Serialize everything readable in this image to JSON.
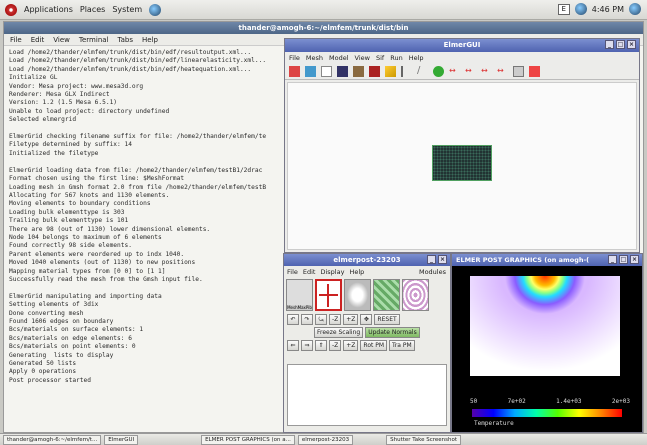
{
  "topbar": {
    "menus": [
      "Applications",
      "Places",
      "System"
    ],
    "clock": "4:46 PM"
  },
  "terminal": {
    "title": "thander@amogh-6:~/elmfem/trunk/dist/bin",
    "menus": [
      "File",
      "Edit",
      "View",
      "Terminal",
      "Tabs",
      "Help"
    ],
    "lines": [
      "Load /home2/thander/elmfem/trunk/dist/bin/edf/resultoutput.xml...",
      "Load /home2/thander/elmfem/trunk/dist/bin/edf/linearelasticity.xml...",
      "Load /home2/thander/elmfem/trunk/dist/bin/edf/heatequation.xml...",
      "Initialize GL",
      "Vendor: Mesa project: www.mesa3d.org",
      "Renderer: Mesa GLX Indirect",
      "Version: 1.2 (1.5 Mesa 6.5.1)",
      "Unable to load project: directory undefined",
      "Selected elmergrid",
      "",
      "ElmerGrid checking filename suffix for file: /home2/thander/elmfem/te",
      "Filetype determined by suffix: 14",
      "Initialized the filetype",
      "",
      "ElmerGrid loading data from file: /home2/thander/elmfem/testB1/2drac",
      "Format chosen using the first line: $MeshFormat",
      "Loading mesh in Gmsh format 2.0 from file /home2/thander/elmfem/testB",
      "Allocating for 567 knots and 1130 elements.",
      "Moving elements to boundary conditions",
      "Loading bulk elementtype is 303",
      "Trailing bulk elementtype is 101",
      "There are 98 (out of 1130) lower dimensional elements.",
      "Node 104 belongs to maximum of 6 elements",
      "Found correctly 98 side elements.",
      "Parent elements were reordered up to indx 1040.",
      "Moved 1040 elements (out of 1130) to new positions",
      "Mapping material types from [0 0] to [1 1]",
      "Successfully read the mesh from the Gmsh input file.",
      "",
      "ElmerGrid manipulating and importing data",
      "Setting elements of 3dix",
      "Done converting mesh",
      "Found 1606 edges on boundary",
      "Bcs/materials on surface elements: 1",
      "Bcs/materials on edge elements: 6",
      "Bcs/materials on point elements: 0",
      "Generating  lists to display",
      "Generated 50 lists",
      "Apply 0 operations",
      "Post processor started"
    ]
  },
  "elmergui": {
    "title": "ElmerGUI",
    "menus": [
      "File",
      "Mesh",
      "Model",
      "View",
      "Sif",
      "Run",
      "Help"
    ]
  },
  "post": {
    "title": "elmerpost-23203",
    "menus": [
      "File",
      "Edit",
      "Display",
      "Help"
    ],
    "modules_label": "Modules",
    "thumb_label": "MeshMaxPib",
    "reset_label": "RESET",
    "freeze_label": "Freeze Scaling",
    "update_label": "Update Normals",
    "rot_labels": [
      "-Z",
      "+Z"
    ],
    "trans_labels": [
      "-Z",
      "+Z"
    ],
    "rot_pm_label": "Rot PM",
    "tra_pm_label": "Tra PM"
  },
  "graphics": {
    "title": "ELMER POST GRAPHICS (on amogh-(",
    "colorbar_labels": [
      "50",
      "7e+02",
      "1.4e+03",
      "2e+03"
    ],
    "colorbar_name": "Temperature"
  },
  "taskbar": {
    "items": [
      "thander@amogh-6:~/elmfem/t...",
      "ElmerGUI",
      "ELMER POST GRAPHICS (on a...",
      "elmerpost-23203",
      "Shutter Take Screenshot"
    ]
  }
}
